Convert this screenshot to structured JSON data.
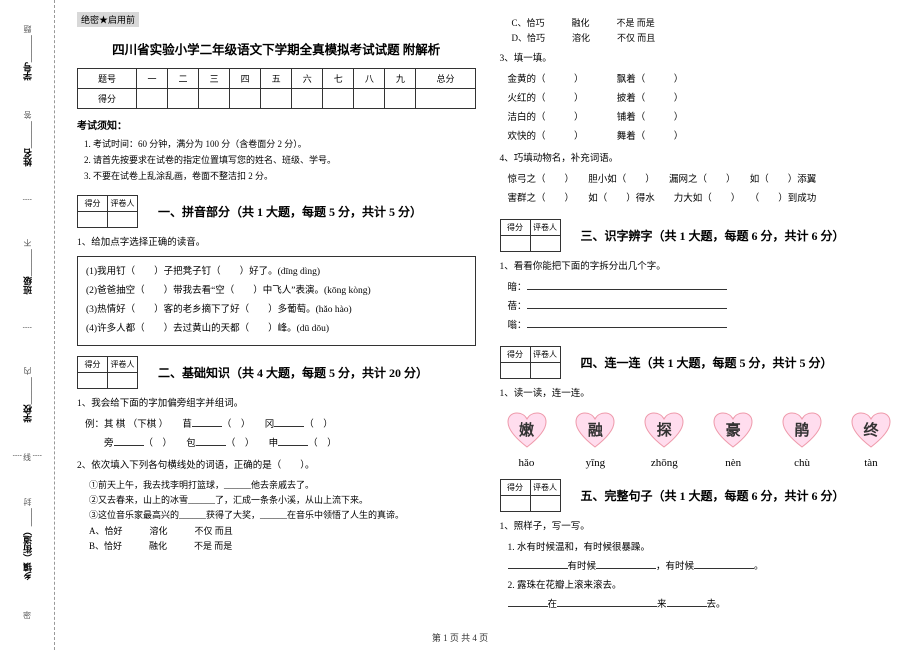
{
  "sidebar": {
    "items": [
      {
        "label": "学号",
        "extra": "题"
      },
      {
        "label": "姓名",
        "extra": "答"
      },
      {
        "label": "班级",
        "extra": "准",
        "sep": "不"
      },
      {
        "label": "学校",
        "extra": "内",
        "sep": "线"
      },
      {
        "label": "乡镇（街道）",
        "extra": "",
        "sep": "封"
      }
    ],
    "seal": "密"
  },
  "header": {
    "secret": "绝密★启用前",
    "title": "四川省实验小学二年级语文下学期全真模拟考试试题 附解析"
  },
  "score_table": {
    "row1": [
      "题号",
      "一",
      "二",
      "三",
      "四",
      "五",
      "六",
      "七",
      "八",
      "九",
      "总分"
    ],
    "row2": [
      "得分",
      "",
      "",
      "",
      "",
      "",
      "",
      "",
      "",
      "",
      ""
    ]
  },
  "notice": {
    "title": "考试须知：",
    "items": [
      "考试时间：60 分钟，满分为 100 分（含卷面分 2 分）。",
      "请首先按要求在试卷的指定位置填写您的姓名、班级、学号。",
      "不要在试卷上乱涂乱画，卷面不整洁扣 2 分。"
    ]
  },
  "mini": {
    "c1": "得分",
    "c2": "评卷人"
  },
  "parts": {
    "p1": {
      "title": "一、拼音部分（共 1 大题，每题 5 分，共计 5 分）"
    },
    "p2": {
      "title": "二、基础知识（共 4 大题，每题 5 分，共计 20 分）"
    },
    "p3": {
      "title": "三、识字辨字（共 1 大题，每题 6 分，共计 6 分）"
    },
    "p4": {
      "title": "四、连一连（共 1 大题，每题 5 分，共计 5 分）"
    },
    "p5": {
      "title": "五、完整句子（共 1 大题，每题 6 分，共计 6 分）"
    }
  },
  "q_pinyin": {
    "lead": "1、给加点字选择正确的读音。",
    "rows": [
      "(1)我用钉（　　）子把凳子钉（　　）好了。(dīng  dìng)",
      "(2)爸爸抽空（　　）带我去看“空（　　）中飞人”表演。(kōng  kòng)",
      "(3)热情好（　　）客的老乡摘下了好（　　）多葡萄。(hǎo  hào)",
      "(4)许多人都（　　）去过黄山的天都（　　）峰。(dū  dōu)"
    ]
  },
  "q_base1": {
    "lead": "1、我会给下面的字加偏旁组字并组词。",
    "example": "例：其 棋 （下棋 ）",
    "row1a": "苜",
    "row1b": "冈",
    "row2a": "旁",
    "row2b": "包",
    "row2c": "申"
  },
  "q_base2": {
    "lead": "2、依次填入下列各句横线处的词语，正确的是（　　）。",
    "s1": "①前天上午，我去找李明打篮球，______他去亲戚去了。",
    "s2": "②又去春来，山上的冰雪______了，汇成一条条小溪，从山上流下来。",
    "s3": "③这位音乐家最高兴的______获得了大奖，______在音乐中领悟了人生的真谛。",
    "optA": "A、恰好　　　溶化　　　不仅 而且",
    "optB": "B、恰好　　　融化　　　不是 而是",
    "optC": "C、恰巧　　　融化　　　不是 而是",
    "optD": "D、恰巧　　　溶化　　　不仅 而且"
  },
  "q_base3": {
    "lead": "3、填一填。",
    "rows": [
      [
        "金黄的（　　　）",
        "飘着（　　　）"
      ],
      [
        "火红的（　　　）",
        "披着（　　　）"
      ],
      [
        "洁白的（　　　）",
        "铺着（　　　）"
      ],
      [
        "欢快的（　　　）",
        "舞着（　　　）"
      ]
    ]
  },
  "q_base4": {
    "lead": "4、巧填动物名，补充词语。",
    "row1": "惊弓之（　　）　　胆小如（　　）　　漏网之（　　）　　如（　　）添翼",
    "row2": "害群之（　　）　　如（　　）得水　　力大如（　　）　　（　　）到成功"
  },
  "q_p3": {
    "lead": "1、看看你能把下面的字拆分出几个字。",
    "rows": [
      "暗：",
      "蓓：",
      "嗡："
    ]
  },
  "q_p4": {
    "lead": "1、读一读，连一连。",
    "hearts": [
      "嫩",
      "融",
      "探",
      "豪",
      "鹃",
      "终"
    ],
    "pinyin": [
      "hǎo",
      "yīng",
      "zhōng",
      "nèn",
      "chù",
      "tàn"
    ]
  },
  "q_p5": {
    "lead": "1、照样子，写一写。",
    "s1": "1. 水有时候温和，有时候很暴躁。",
    "s1blank_a": "有时候",
    "s1blank_b": "，有时候",
    "s2": "2. 露珠在花瓣上滚来滚去。",
    "s2blank_a": "在",
    "s2blank_b": "来",
    "s2blank_c": "去。"
  },
  "footer": "第 1 页 共 4 页"
}
